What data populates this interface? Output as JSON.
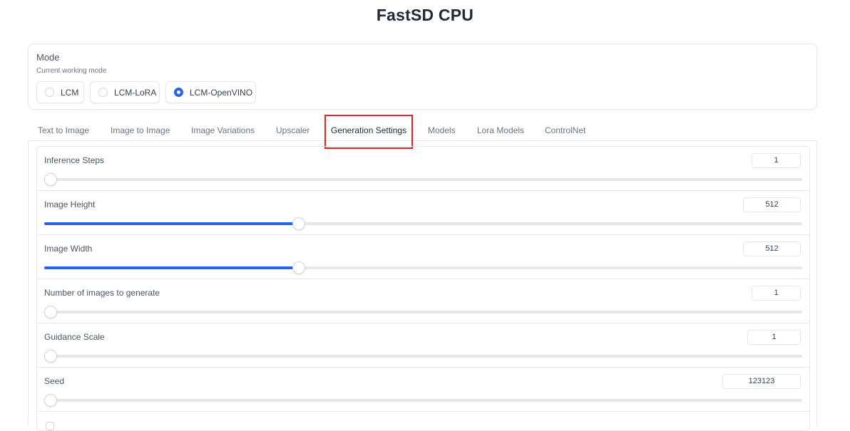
{
  "app": {
    "title": "FastSD CPU"
  },
  "mode": {
    "label": "Mode",
    "info": "Current working mode",
    "options": [
      {
        "label": "LCM",
        "checked": false
      },
      {
        "label": "LCM-LoRA",
        "checked": false
      },
      {
        "label": "LCM-OpenVINO",
        "checked": true
      }
    ]
  },
  "tabs": [
    {
      "label": "Text to Image"
    },
    {
      "label": "Image to Image"
    },
    {
      "label": "Image Variations"
    },
    {
      "label": "Upscaler"
    },
    {
      "label": "Generation Settings",
      "active": true
    },
    {
      "label": "Models"
    },
    {
      "label": "Lora Models"
    },
    {
      "label": "ControlNet"
    }
  ],
  "settings": {
    "inference_steps": {
      "label": "Inference Steps",
      "value": "1",
      "fraction": 0.0
    },
    "image_height": {
      "label": "Image Height",
      "value": "512",
      "fraction": 0.336
    },
    "image_width": {
      "label": "Image Width",
      "value": "512",
      "fraction": 0.336
    },
    "num_images": {
      "label": "Number of images to generate",
      "value": "1",
      "fraction": 0.0
    },
    "guidance_scale": {
      "label": "Guidance Scale",
      "value": "1",
      "fraction": 0.0
    },
    "seed": {
      "label": "Seed",
      "value": "123123",
      "fraction": 0.0
    }
  },
  "colors": {
    "accent": "#2563eb",
    "highlight": "#e02424"
  }
}
